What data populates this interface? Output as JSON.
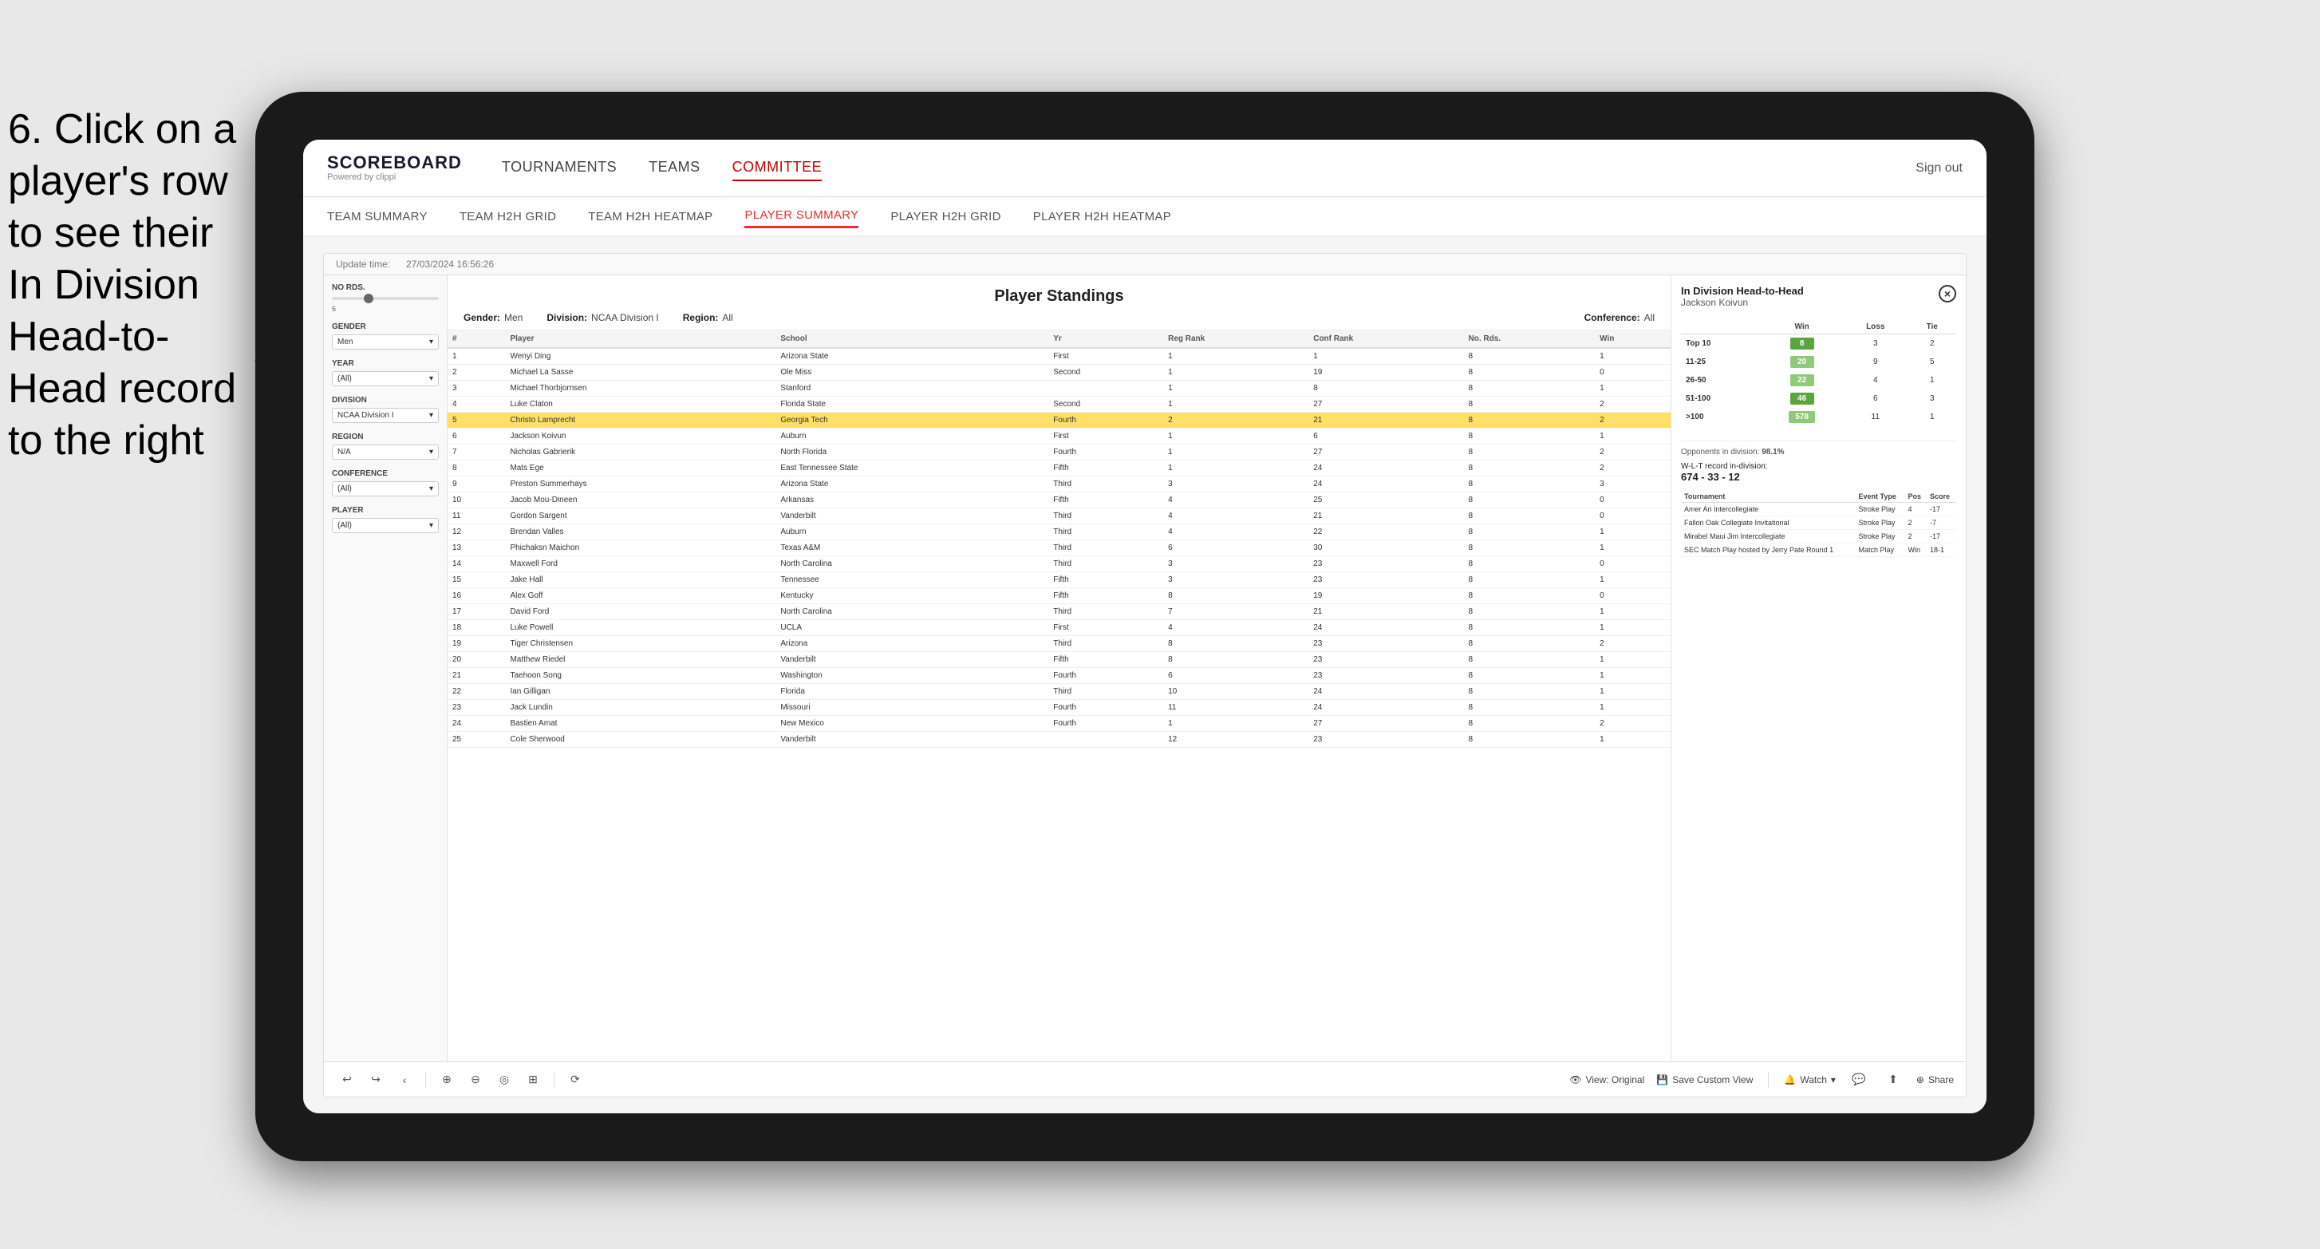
{
  "instruction": {
    "text": "6. Click on a player's row to see their In Division Head-to-Head record to the right"
  },
  "header": {
    "logo_title": "SCOREBOARD",
    "logo_subtitle": "Powered by clippi",
    "nav_items": [
      "TOURNAMENTS",
      "TEAMS",
      "COMMITTEE"
    ],
    "sign_out": "Sign out"
  },
  "sub_nav": {
    "items": [
      "TEAM SUMMARY",
      "TEAM H2H GRID",
      "TEAM H2H HEATMAP",
      "PLAYER SUMMARY",
      "PLAYER H2H GRID",
      "PLAYER H2H HEATMAP"
    ],
    "active": "PLAYER SUMMARY"
  },
  "powerbi_bar": {
    "update_label": "Update time:",
    "update_time": "27/03/2024 16:56:26"
  },
  "standings": {
    "title": "Player Standings",
    "gender_label": "Gender:",
    "gender_value": "Men",
    "division_label": "Division:",
    "division_value": "NCAA Division I",
    "region_label": "Region:",
    "region_value": "All",
    "conference_label": "Conference:",
    "conference_value": "All",
    "columns": [
      "#",
      "Player",
      "School",
      "Yr",
      "Reg Rank",
      "Conf Rank",
      "No. Rds.",
      "Win"
    ],
    "rows": [
      {
        "num": "1",
        "player": "Wenyi Ding",
        "school": "Arizona State",
        "yr": "First",
        "reg": "1",
        "conf": "1",
        "rds": "8",
        "win": "1"
      },
      {
        "num": "2",
        "player": "Michael La Sasse",
        "school": "Ole Miss",
        "yr": "Second",
        "reg": "1",
        "conf": "19",
        "rds": "8",
        "win": "0"
      },
      {
        "num": "3",
        "player": "Michael Thorbjornsen",
        "school": "Stanford",
        "yr": "",
        "reg": "1",
        "conf": "8",
        "rds": "8",
        "win": "1"
      },
      {
        "num": "4",
        "player": "Luke Claton",
        "school": "Florida State",
        "yr": "Second",
        "reg": "1",
        "conf": "27",
        "rds": "8",
        "win": "2"
      },
      {
        "num": "5",
        "player": "Christo Lamprecht",
        "school": "Georgia Tech",
        "yr": "Fourth",
        "reg": "2",
        "conf": "21",
        "rds": "8",
        "win": "2"
      },
      {
        "num": "6",
        "player": "Jackson Koivun",
        "school": "Auburn",
        "yr": "First",
        "reg": "1",
        "conf": "6",
        "rds": "8",
        "win": "1"
      },
      {
        "num": "7",
        "player": "Nicholas Gabrierik",
        "school": "North Florida",
        "yr": "Fourth",
        "reg": "1",
        "conf": "27",
        "rds": "8",
        "win": "2"
      },
      {
        "num": "8",
        "player": "Mats Ege",
        "school": "East Tennessee State",
        "yr": "Fifth",
        "reg": "1",
        "conf": "24",
        "rds": "8",
        "win": "2"
      },
      {
        "num": "9",
        "player": "Preston Summerhays",
        "school": "Arizona State",
        "yr": "Third",
        "reg": "3",
        "conf": "24",
        "rds": "8",
        "win": "3"
      },
      {
        "num": "10",
        "player": "Jacob Mou-Dineen",
        "school": "Arkansas",
        "yr": "Fifth",
        "reg": "4",
        "conf": "25",
        "rds": "8",
        "win": "0"
      },
      {
        "num": "11",
        "player": "Gordon Sargent",
        "school": "Vanderbilt",
        "yr": "Third",
        "reg": "4",
        "conf": "21",
        "rds": "8",
        "win": "0"
      },
      {
        "num": "12",
        "player": "Brendan Valles",
        "school": "Auburn",
        "yr": "Third",
        "reg": "4",
        "conf": "22",
        "rds": "8",
        "win": "1"
      },
      {
        "num": "13",
        "player": "Phichaksn Maichon",
        "school": "Texas A&M",
        "yr": "Third",
        "reg": "6",
        "conf": "30",
        "rds": "8",
        "win": "1"
      },
      {
        "num": "14",
        "player": "Maxwell Ford",
        "school": "North Carolina",
        "yr": "Third",
        "reg": "3",
        "conf": "23",
        "rds": "8",
        "win": "0"
      },
      {
        "num": "15",
        "player": "Jake Hall",
        "school": "Tennessee",
        "yr": "Fifth",
        "reg": "3",
        "conf": "23",
        "rds": "8",
        "win": "1"
      },
      {
        "num": "16",
        "player": "Alex Goff",
        "school": "Kentucky",
        "yr": "Fifth",
        "reg": "8",
        "conf": "19",
        "rds": "8",
        "win": "0"
      },
      {
        "num": "17",
        "player": "David Ford",
        "school": "North Carolina",
        "yr": "Third",
        "reg": "7",
        "conf": "21",
        "rds": "8",
        "win": "1"
      },
      {
        "num": "18",
        "player": "Luke Powell",
        "school": "UCLA",
        "yr": "First",
        "reg": "4",
        "conf": "24",
        "rds": "8",
        "win": "1"
      },
      {
        "num": "19",
        "player": "Tiger Christensen",
        "school": "Arizona",
        "yr": "Third",
        "reg": "8",
        "conf": "23",
        "rds": "8",
        "win": "2"
      },
      {
        "num": "20",
        "player": "Matthew Riedel",
        "school": "Vanderbilt",
        "yr": "Fifth",
        "reg": "8",
        "conf": "23",
        "rds": "8",
        "win": "1"
      },
      {
        "num": "21",
        "player": "Taehoon Song",
        "school": "Washington",
        "yr": "Fourth",
        "reg": "6",
        "conf": "23",
        "rds": "8",
        "win": "1"
      },
      {
        "num": "22",
        "player": "Ian Gilligan",
        "school": "Florida",
        "yr": "Third",
        "reg": "10",
        "conf": "24",
        "rds": "8",
        "win": "1"
      },
      {
        "num": "23",
        "player": "Jack Lundin",
        "school": "Missouri",
        "yr": "Fourth",
        "reg": "11",
        "conf": "24",
        "rds": "8",
        "win": "1"
      },
      {
        "num": "24",
        "player": "Bastien Amat",
        "school": "New Mexico",
        "yr": "Fourth",
        "reg": "1",
        "conf": "27",
        "rds": "8",
        "win": "2"
      },
      {
        "num": "25",
        "player": "Cole Sherwood",
        "school": "Vanderbilt",
        "yr": "",
        "reg": "12",
        "conf": "23",
        "rds": "8",
        "win": "1"
      }
    ],
    "selected_row": 5
  },
  "filters": {
    "no_rds_label": "No Rds.",
    "no_rds_min": "6",
    "gender_label": "Gender",
    "gender_value": "Men",
    "year_label": "Year",
    "year_value": "(All)",
    "division_label": "Division",
    "division_value": "NCAA Division I",
    "region_label": "Region",
    "region_value": "N/A",
    "conference_label": "Conference",
    "conference_value": "(All)",
    "player_label": "Player",
    "player_value": "(All)"
  },
  "h2h": {
    "title": "In Division Head-to-Head",
    "player_name": "Jackson Koivun",
    "close_label": "×",
    "table_headers": [
      "",
      "Win",
      "Loss",
      "Tie"
    ],
    "rows": [
      {
        "rank": "Top 10",
        "win": "8",
        "loss": "3",
        "tie": "2",
        "win_class": "dark"
      },
      {
        "rank": "11-25",
        "win": "20",
        "loss": "9",
        "tie": "5",
        "win_class": "light"
      },
      {
        "rank": "26-50",
        "win": "22",
        "loss": "4",
        "tie": "1",
        "win_class": "light"
      },
      {
        "rank": "51-100",
        "win": "46",
        "loss": "6",
        "tie": "3",
        "win_class": "dark"
      },
      {
        "rank": ">100",
        "win": "578",
        "loss": "11",
        "tie": "1",
        "win_class": "light"
      }
    ],
    "opponents_label": "Opponents in division:",
    "wlt_label": "W-L-T record in-division:",
    "opponents_pct": "98.1%",
    "record": "674 - 33 - 12",
    "tournament_headers": [
      "Tournament",
      "Event Type",
      "Pos",
      "Score"
    ],
    "tournaments": [
      {
        "name": "Amer Ari Intercollegiate",
        "type": "Stroke Play",
        "pos": "4",
        "score": "-17"
      },
      {
        "name": "Fallon Oak Collegiate Invitational",
        "type": "Stroke Play",
        "pos": "2",
        "score": "-7"
      },
      {
        "name": "Mirabel Maui Jim Intercollegiate",
        "type": "Stroke Play",
        "pos": "2",
        "score": "-17"
      },
      {
        "name": "SEC Match Play hosted by Jerry Pate Round 1",
        "type": "Match Play",
        "pos": "Win",
        "score": "18-1"
      }
    ]
  },
  "toolbar": {
    "undo_label": "↩",
    "redo_label": "↪",
    "refresh_label": "⟳",
    "view_original": "View: Original",
    "save_custom": "Save Custom View",
    "watch_label": "Watch",
    "share_label": "Share"
  }
}
